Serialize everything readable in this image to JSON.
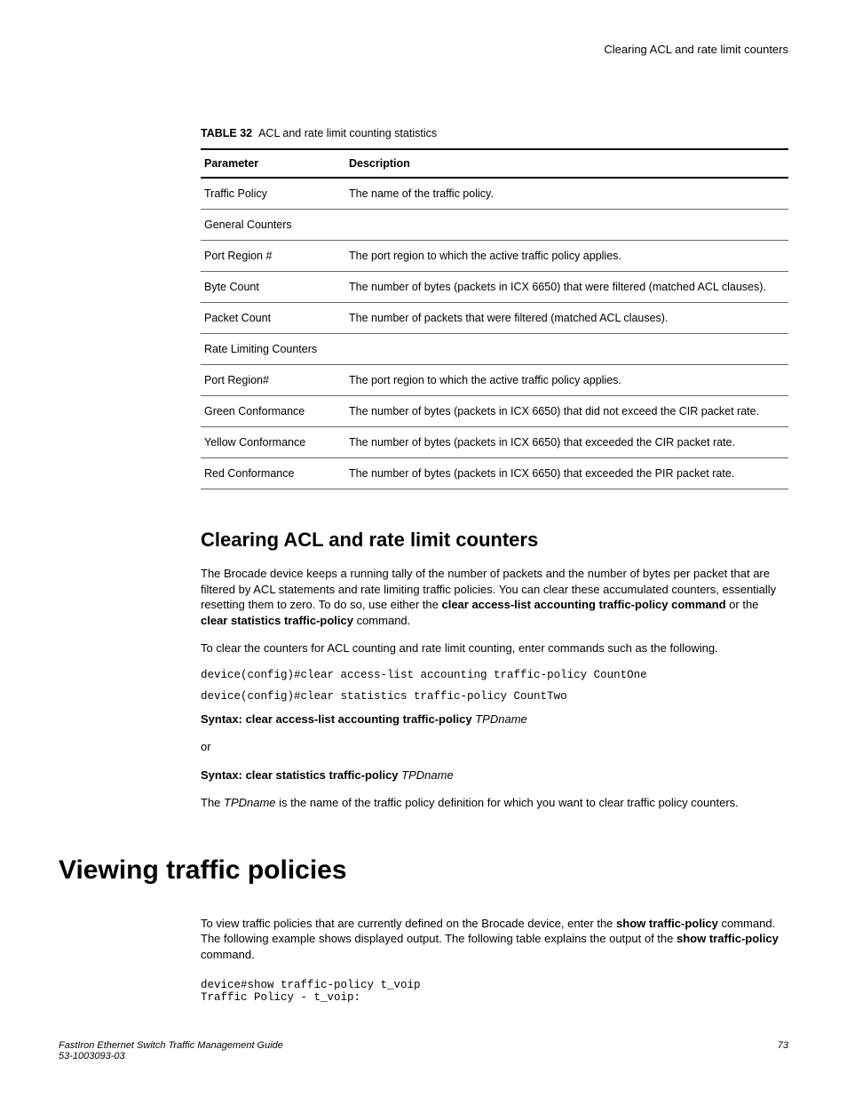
{
  "running_header": "Clearing ACL and rate limit counters",
  "table": {
    "label": "TABLE 32",
    "caption": "ACL and rate limit counting statistics",
    "headers": {
      "c1": "Parameter",
      "c2": "Description"
    },
    "rows": {
      "r0": {
        "param": "Traffic Policy",
        "desc": "The name of the traffic policy."
      },
      "r1": {
        "param": "General Counters",
        "desc": ""
      },
      "r2": {
        "param": "Port Region #",
        "desc": "The port region to which the active traffic policy applies."
      },
      "r3": {
        "param": "Byte Count",
        "desc": "The number of bytes (packets in ICX 6650) that were filtered (matched ACL clauses)."
      },
      "r4": {
        "param": "Packet Count",
        "desc": "The number of packets that were filtered (matched ACL clauses)."
      },
      "r5": {
        "param": "Rate Limiting Counters",
        "desc": ""
      },
      "r6": {
        "param": "Port Region#",
        "desc": "The port region to which the active traffic policy applies."
      },
      "r7": {
        "param": "Green Conformance",
        "desc": "The number of bytes (packets in ICX 6650) that did not exceed the CIR packet rate."
      },
      "r8": {
        "param": "Yellow Conformance",
        "desc": "The number of bytes (packets in ICX 6650) that exceeded the CIR packet rate."
      },
      "r9": {
        "param": "Red Conformance",
        "desc": "The number of bytes (packets in ICX 6650) that exceeded the PIR packet rate."
      }
    }
  },
  "sec1": {
    "heading": "Clearing ACL and rate limit counters",
    "p1a": "The Brocade device keeps a running tally of the number of packets and the number of bytes per packet that are filtered by ACL statements and rate limiting traffic policies. You can clear these accumulated counters, essentially resetting them to zero. To do so, use either the ",
    "p1b": "clear access-list accounting traffic-policy command",
    "p1c": " or the ",
    "p1d": "clear statistics traffic-policy",
    "p1e": " command.",
    "p2": "To clear the counters for ACL counting and rate limit counting, enter commands such as the following.",
    "code1": "device(config)#clear access-list accounting traffic-policy CountOne",
    "code2": "device(config)#clear statistics traffic-policy CountTwo",
    "syn1a": "Syntax: clear access-list accounting traffic-policy ",
    "syn1b": "TPDname",
    "or": "or",
    "syn2a": "Syntax: clear statistics traffic-policy ",
    "syn2b": "TPDname",
    "p3a": "The ",
    "p3b": "TPDname",
    "p3c": " is the name of the traffic policy definition for which you want to clear traffic policy counters."
  },
  "sec2": {
    "heading": "Viewing traffic policies",
    "p1a": "To view traffic policies that are currently defined on the Brocade device, enter the ",
    "p1b": "show traffic-policy",
    "p1c": " command. The following example shows displayed output. The following table explains the output of the ",
    "p1d": "show traffic-policy",
    "p1e": " command.",
    "code": "device#show traffic-policy t_voip\nTraffic Policy - t_voip:"
  },
  "footer": {
    "title": "FastIron Ethernet Switch Traffic Management Guide",
    "docnum": "53-1003093-03",
    "page": "73"
  }
}
